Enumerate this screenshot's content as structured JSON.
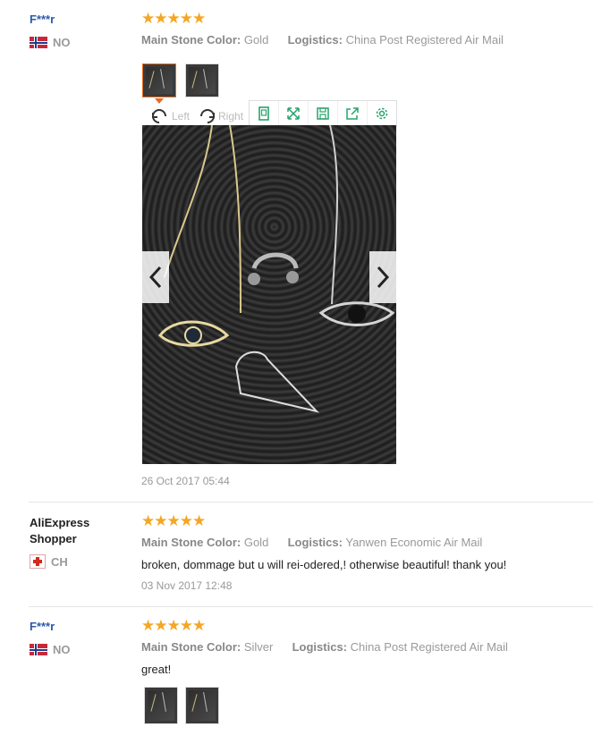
{
  "reviews": [
    {
      "user": "F***r",
      "country": "NO",
      "stars": "★★★★★",
      "props": [
        {
          "label": "Main Stone Color:",
          "value": "Gold"
        },
        {
          "label": "Logistics:",
          "value": "China Post Registered Air Mail"
        }
      ],
      "viewer": {
        "rotate_left": "Left",
        "rotate_right": "Right",
        "tools": [
          "fit-icon",
          "fullscreen-icon",
          "save-icon",
          "share-icon",
          "settings-icon"
        ]
      },
      "date": "26 Oct 2017 05:44"
    },
    {
      "user": "AliExpress Shopper",
      "country": "CH",
      "stars": "★★★★★",
      "props": [
        {
          "label": "Main Stone Color:",
          "value": "Gold"
        },
        {
          "label": "Logistics:",
          "value": "Yanwen Economic Air Mail"
        }
      ],
      "text": "broken, dommage but u will rei-odered,! otherwise beautiful! thank you!",
      "date": "03 Nov 2017 12:48"
    },
    {
      "user": "F***r",
      "country": "NO",
      "stars": "★★★★★",
      "props": [
        {
          "label": "Main Stone Color:",
          "value": "Silver"
        },
        {
          "label": "Logistics:",
          "value": "China Post Registered Air Mail"
        }
      ],
      "text": "great!"
    }
  ],
  "colors": {
    "star": "#f5a623",
    "masked_user": "#2b5aa8",
    "tool_icon": "#27a36b",
    "thumb_active": "#e86b1c"
  }
}
